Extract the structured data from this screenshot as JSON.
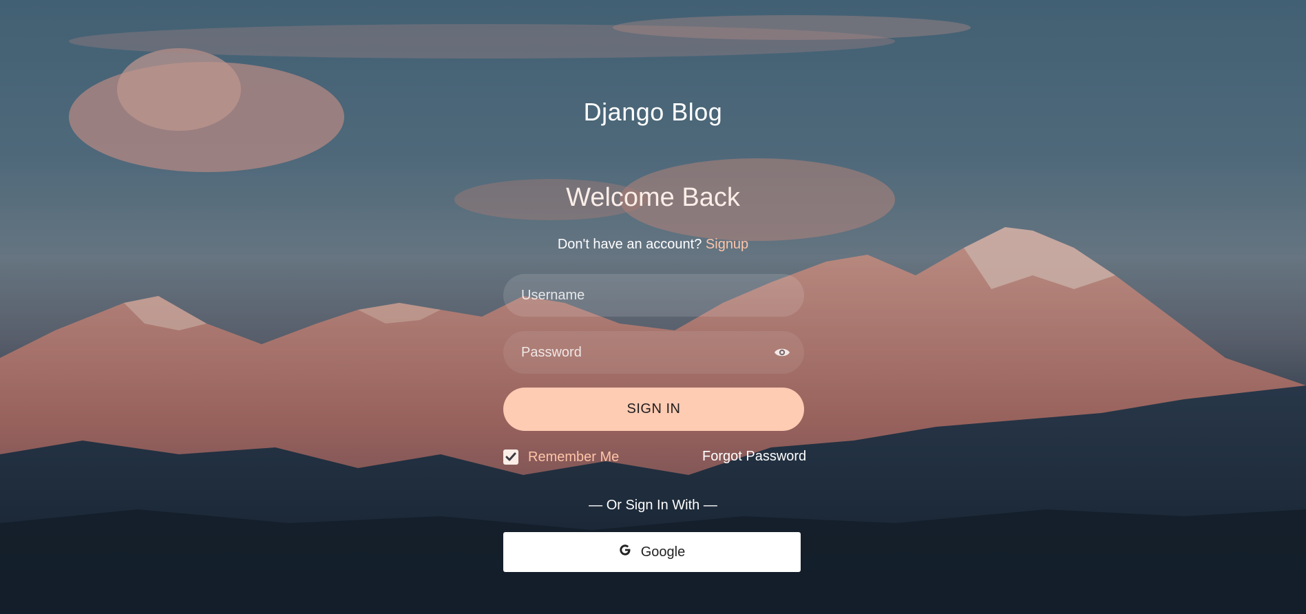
{
  "brand": {
    "title": "Django Blog"
  },
  "heading": {
    "welcome": "Welcome Back"
  },
  "signup": {
    "prompt": "Don't have an account?",
    "link_label": "Signup"
  },
  "form": {
    "username_placeholder": "Username",
    "password_placeholder": "Password",
    "signin_label": "SIGN IN",
    "remember_label": "Remember Me",
    "remember_checked": true,
    "forgot_label": "Forgot Password"
  },
  "social": {
    "divider_label": "— Or Sign In With —",
    "google_label": "Google"
  },
  "colors": {
    "accent": "#fecbb3",
    "link": "#ffc5a8",
    "text": "#ffffff"
  },
  "icons": {
    "password_toggle": "eye-icon",
    "google": "google-icon",
    "checkbox": "check-icon"
  }
}
